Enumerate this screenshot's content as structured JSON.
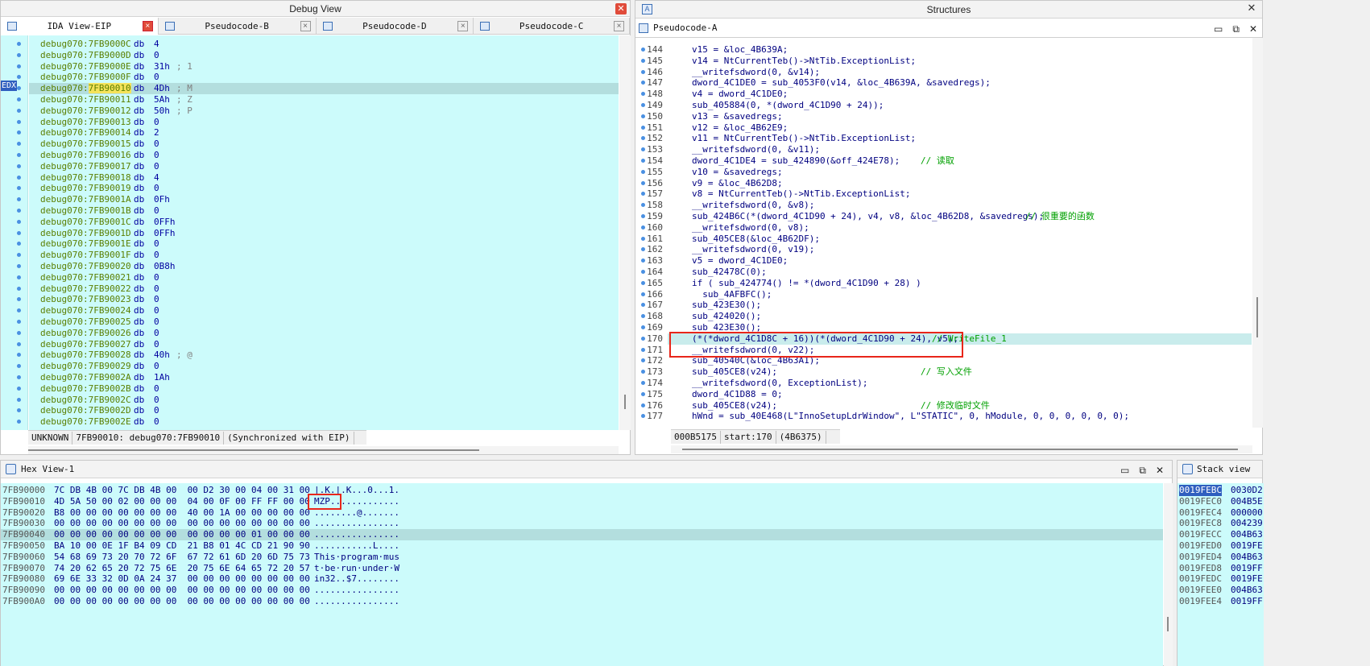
{
  "debug_view": {
    "title": "Debug View",
    "tabs": [
      "IDA View-EIP",
      "Pseudocode-B",
      "Pseudocode-D",
      "Pseudocode-C"
    ],
    "edx_label": "EDX",
    "lines": [
      {
        "addr": "debug070:7FB9000C",
        "op": "db",
        "val": "4",
        "cmt": ""
      },
      {
        "addr": "debug070:7FB9000D",
        "op": "db",
        "val": "0",
        "cmt": ""
      },
      {
        "addr": "debug070:7FB9000E",
        "op": "db",
        "val": "31h",
        "cmt": "; 1"
      },
      {
        "addr": "debug070:7FB9000F",
        "op": "db",
        "val": "0",
        "cmt": ""
      },
      {
        "addr": "debug070:7FB90010",
        "op": "db",
        "val": "4Dh",
        "cmt": "; M"
      },
      {
        "addr": "debug070:7FB90011",
        "op": "db",
        "val": "5Ah",
        "cmt": "; Z"
      },
      {
        "addr": "debug070:7FB90012",
        "op": "db",
        "val": "50h",
        "cmt": "; P"
      },
      {
        "addr": "debug070:7FB90013",
        "op": "db",
        "val": "0",
        "cmt": ""
      },
      {
        "addr": "debug070:7FB90014",
        "op": "db",
        "val": "2",
        "cmt": ""
      },
      {
        "addr": "debug070:7FB90015",
        "op": "db",
        "val": "0",
        "cmt": ""
      },
      {
        "addr": "debug070:7FB90016",
        "op": "db",
        "val": "0",
        "cmt": ""
      },
      {
        "addr": "debug070:7FB90017",
        "op": "db",
        "val": "0",
        "cmt": ""
      },
      {
        "addr": "debug070:7FB90018",
        "op": "db",
        "val": "4",
        "cmt": ""
      },
      {
        "addr": "debug070:7FB90019",
        "op": "db",
        "val": "0",
        "cmt": ""
      },
      {
        "addr": "debug070:7FB9001A",
        "op": "db",
        "val": "0Fh",
        "cmt": ""
      },
      {
        "addr": "debug070:7FB9001B",
        "op": "db",
        "val": "0",
        "cmt": ""
      },
      {
        "addr": "debug070:7FB9001C",
        "op": "db",
        "val": "0FFh",
        "cmt": ""
      },
      {
        "addr": "debug070:7FB9001D",
        "op": "db",
        "val": "0FFh",
        "cmt": ""
      },
      {
        "addr": "debug070:7FB9001E",
        "op": "db",
        "val": "0",
        "cmt": ""
      },
      {
        "addr": "debug070:7FB9001F",
        "op": "db",
        "val": "0",
        "cmt": ""
      },
      {
        "addr": "debug070:7FB90020",
        "op": "db",
        "val": "0B8h",
        "cmt": ""
      },
      {
        "addr": "debug070:7FB90021",
        "op": "db",
        "val": "0",
        "cmt": ""
      },
      {
        "addr": "debug070:7FB90022",
        "op": "db",
        "val": "0",
        "cmt": ""
      },
      {
        "addr": "debug070:7FB90023",
        "op": "db",
        "val": "0",
        "cmt": ""
      },
      {
        "addr": "debug070:7FB90024",
        "op": "db",
        "val": "0",
        "cmt": ""
      },
      {
        "addr": "debug070:7FB90025",
        "op": "db",
        "val": "0",
        "cmt": ""
      },
      {
        "addr": "debug070:7FB90026",
        "op": "db",
        "val": "0",
        "cmt": ""
      },
      {
        "addr": "debug070:7FB90027",
        "op": "db",
        "val": "0",
        "cmt": ""
      },
      {
        "addr": "debug070:7FB90028",
        "op": "db",
        "val": "40h",
        "cmt": "; @"
      },
      {
        "addr": "debug070:7FB90029",
        "op": "db",
        "val": "0",
        "cmt": ""
      },
      {
        "addr": "debug070:7FB9002A",
        "op": "db",
        "val": "1Ah",
        "cmt": ""
      },
      {
        "addr": "debug070:7FB9002B",
        "op": "db",
        "val": "0",
        "cmt": ""
      },
      {
        "addr": "debug070:7FB9002C",
        "op": "db",
        "val": "0",
        "cmt": ""
      },
      {
        "addr": "debug070:7FB9002D",
        "op": "db",
        "val": "0",
        "cmt": ""
      },
      {
        "addr": "debug070:7FB9002E",
        "op": "db",
        "val": "0",
        "cmt": ""
      }
    ],
    "status": [
      "UNKNOWN",
      "7FB90010: debug070:7FB90010",
      "(Synchronized with EIP)"
    ]
  },
  "structures": {
    "title": "Structures",
    "subtab": "Pseudocode-A",
    "lines": [
      {
        "n": "144",
        "code": "v15 = &loc_4B639A;",
        "cmt": ""
      },
      {
        "n": "145",
        "code": "v14 = NtCurrentTeb()->NtTib.ExceptionList;",
        "cmt": ""
      },
      {
        "n": "146",
        "code": "__writefsdword(0, &v14);",
        "cmt": ""
      },
      {
        "n": "147",
        "code": "dword_4C1DE0 = sub_4053F0(v14, &loc_4B639A, &savedregs);",
        "cmt": ""
      },
      {
        "n": "148",
        "code": "v4 = dword_4C1DE0;",
        "cmt": ""
      },
      {
        "n": "149",
        "code": "sub_405884(0, *(dword_4C1D90 + 24));",
        "cmt": ""
      },
      {
        "n": "150",
        "code": "v13 = &savedregs;",
        "cmt": ""
      },
      {
        "n": "151",
        "code": "v12 = &loc_4B62E9;",
        "cmt": ""
      },
      {
        "n": "152",
        "code": "v11 = NtCurrentTeb()->NtTib.ExceptionList;",
        "cmt": ""
      },
      {
        "n": "153",
        "code": "__writefsdword(0, &v11);",
        "cmt": ""
      },
      {
        "n": "154",
        "code": "dword_4C1DE4 = sub_424890(&off_424E78);",
        "cmt": "// 读取"
      },
      {
        "n": "155",
        "code": "v10 = &savedregs;",
        "cmt": ""
      },
      {
        "n": "156",
        "code": "v9 = &loc_4B62D8;",
        "cmt": ""
      },
      {
        "n": "157",
        "code": "v8 = NtCurrentTeb()->NtTib.ExceptionList;",
        "cmt": ""
      },
      {
        "n": "158",
        "code": "__writefsdword(0, &v8);",
        "cmt": ""
      },
      {
        "n": "159",
        "code": "sub_424B6C(*(dword_4C1D90 + 24), v4, v8, &loc_4B62D8, &savedregs);",
        "cmt": "// 很重要的函数"
      },
      {
        "n": "160",
        "code": "__writefsdword(0, v8);",
        "cmt": ""
      },
      {
        "n": "161",
        "code": "sub_405CE8(&loc_4B62DF);",
        "cmt": ""
      },
      {
        "n": "162",
        "code": "__writefsdword(0, v19);",
        "cmt": ""
      },
      {
        "n": "163",
        "code": "v5 = dword_4C1DE0;",
        "cmt": ""
      },
      {
        "n": "164",
        "code": "sub_42478C(0);",
        "cmt": ""
      },
      {
        "n": "165",
        "code": "if ( sub_424774() != *(dword_4C1D90 + 28) )",
        "cmt": ""
      },
      {
        "n": "166",
        "code": "  sub_4AFBFC();",
        "cmt": ""
      },
      {
        "n": "167",
        "code": "sub_423E30();",
        "cmt": ""
      },
      {
        "n": "168",
        "code": "sub_424020();",
        "cmt": ""
      },
      {
        "n": "169",
        "code": "sub_423E30();",
        "cmt": ""
      },
      {
        "n": "170",
        "code": "(*(*dword_4C1D8C + 16))(*(dword_4C1D90 + 24), v5);",
        "cmt": "// WriteFile_1"
      },
      {
        "n": "171",
        "code": "__writefsdword(0, v22);",
        "cmt": ""
      },
      {
        "n": "172",
        "code": "sub_40540C(&loc_4B63A1);",
        "cmt": ""
      },
      {
        "n": "173",
        "code": "sub_405CE8(v24);",
        "cmt": "// 写入文件"
      },
      {
        "n": "174",
        "code": "__writefsdword(0, ExceptionList);",
        "cmt": ""
      },
      {
        "n": "175",
        "code": "dword_4C1D88 = 0;",
        "cmt": ""
      },
      {
        "n": "176",
        "code": "sub_405CE8(v24);",
        "cmt": "// 修改临时文件"
      },
      {
        "n": "177",
        "code": "hWnd = sub_40E468(L\"InnoSetupLdrWindow\", L\"STATIC\", 0, hModule, 0, 0, 0, 0, 0, 0);",
        "cmt": ""
      }
    ],
    "status": [
      "000B5175",
      "start:170",
      "(4B6375)"
    ]
  },
  "hex_view": {
    "title": "Hex View-1",
    "rows": [
      {
        "addr": "7FB90000",
        "bytes": "7C DB 4B 00 7C DB 4B 00  00 D2 30 00 04 00 31 00",
        "ascii": "|.K.|.K...0...1."
      },
      {
        "addr": "7FB90010",
        "bytes": "4D 5A 50 00 02 00 00 00  04 00 0F 00 FF FF 00 00",
        "ascii": "MZP............."
      },
      {
        "addr": "7FB90020",
        "bytes": "B8 00 00 00 00 00 00 00  40 00 1A 00 00 00 00 00",
        "ascii": "........@......."
      },
      {
        "addr": "7FB90030",
        "bytes": "00 00 00 00 00 00 00 00  00 00 00 00 00 00 00 00",
        "ascii": "................"
      },
      {
        "addr": "7FB90040",
        "bytes": "00 00 00 00 00 00 00 00  00 00 00 00 01 00 00 00",
        "ascii": "................"
      },
      {
        "addr": "7FB90050",
        "bytes": "BA 10 00 0E 1F B4 09 CD  21 B8 01 4C CD 21 90 90",
        "ascii": "...........L...."
      },
      {
        "addr": "7FB90060",
        "bytes": "54 68 69 73 20 70 72 6F  67 72 61 6D 20 6D 75 73",
        "ascii": "This·program·mus"
      },
      {
        "addr": "7FB90070",
        "bytes": "74 20 62 65 20 72 75 6E  20 75 6E 64 65 72 20 57",
        "ascii": "t·be·run·under·W"
      },
      {
        "addr": "7FB90080",
        "bytes": "69 6E 33 32 0D 0A 24 37  00 00 00 00 00 00 00 00",
        "ascii": "in32..$7........"
      },
      {
        "addr": "7FB90090",
        "bytes": "00 00 00 00 00 00 00 00  00 00 00 00 00 00 00 00",
        "ascii": "................"
      },
      {
        "addr": "7FB900A0",
        "bytes": "00 00 00 00 00 00 00 00  00 00 00 00 00 00 00 00",
        "ascii": "................"
      }
    ]
  },
  "stack_view": {
    "title": "Stack view",
    "rows": [
      {
        "addr": "0019FEBC",
        "val": "0030D2"
      },
      {
        "addr": "0019FEC0",
        "val": "004B5E"
      },
      {
        "addr": "0019FEC4",
        "val": "000000"
      },
      {
        "addr": "0019FEC8",
        "val": "004239"
      },
      {
        "addr": "0019FECC",
        "val": "004B63"
      },
      {
        "addr": "0019FED0",
        "val": "0019FE"
      },
      {
        "addr": "0019FED4",
        "val": "004B63"
      },
      {
        "addr": "0019FED8",
        "val": "0019FF"
      },
      {
        "addr": "0019FEDC",
        "val": "0019FE"
      },
      {
        "addr": "0019FEE0",
        "val": "004B63"
      },
      {
        "addr": "0019FEE4",
        "val": "0019FF"
      }
    ]
  }
}
